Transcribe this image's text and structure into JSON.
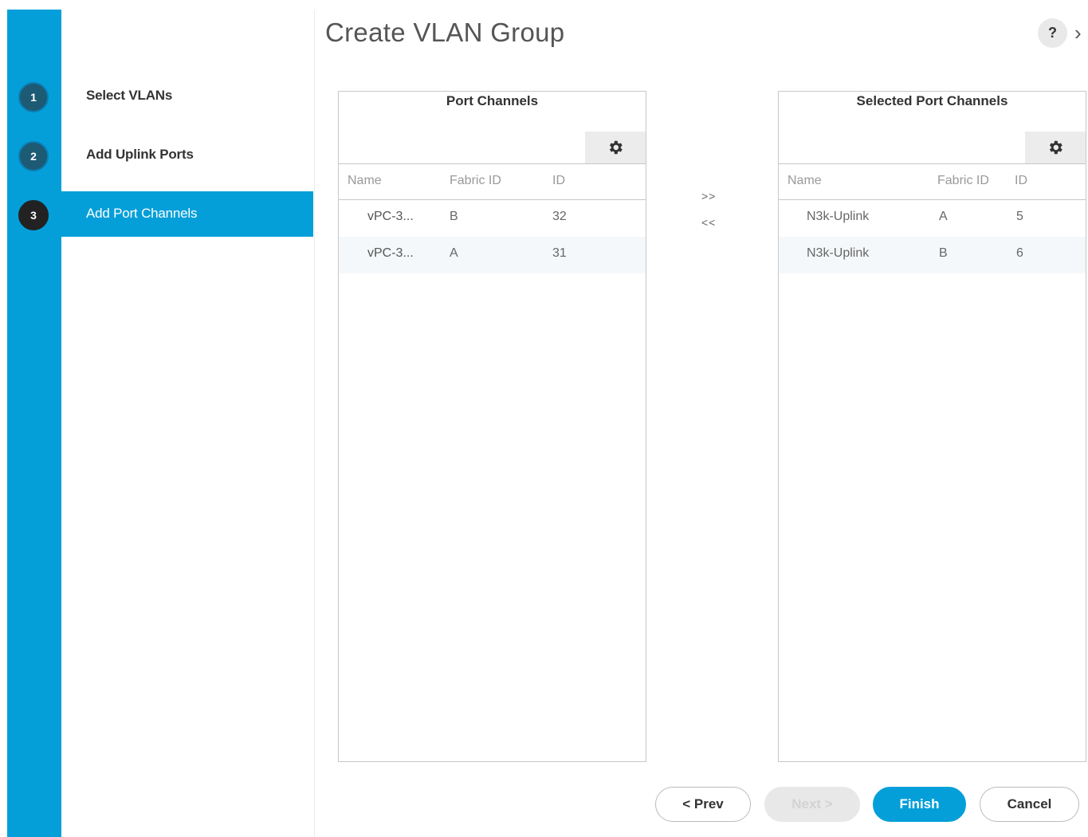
{
  "wizard": {
    "title": "Create VLAN Group",
    "help_label": "?",
    "close_label": "›",
    "steps": [
      {
        "number": "1",
        "label": "Select VLANs",
        "active": false
      },
      {
        "number": "2",
        "label": "Add Uplink Ports",
        "active": false
      },
      {
        "number": "3",
        "label": "Add Port Channels",
        "active": true
      }
    ]
  },
  "available_table": {
    "title": "Port Channels",
    "columns": [
      "Name",
      "Fabric ID",
      "ID"
    ],
    "rows": [
      {
        "name": "vPC-3...",
        "fabric_id": "B",
        "id": "32"
      },
      {
        "name": "vPC-3...",
        "fabric_id": "A",
        "id": "31"
      }
    ]
  },
  "selected_table": {
    "title": "Selected Port Channels",
    "columns": [
      "Name",
      "Fabric ID",
      "ID"
    ],
    "rows": [
      {
        "name": "N3k-Uplink",
        "fabric_id": "A",
        "id": "5"
      },
      {
        "name": "N3k-Uplink",
        "fabric_id": "B",
        "id": "6"
      }
    ]
  },
  "transfer": {
    "add_label": ">>",
    "remove_label": "<<"
  },
  "footer": {
    "prev_label": "< Prev",
    "next_label": "Next >",
    "finish_label": "Finish",
    "cancel_label": "Cancel"
  },
  "colors": {
    "accent": "#049fd9",
    "step_circle": "#1d5a73",
    "active_circle": "#222222"
  }
}
